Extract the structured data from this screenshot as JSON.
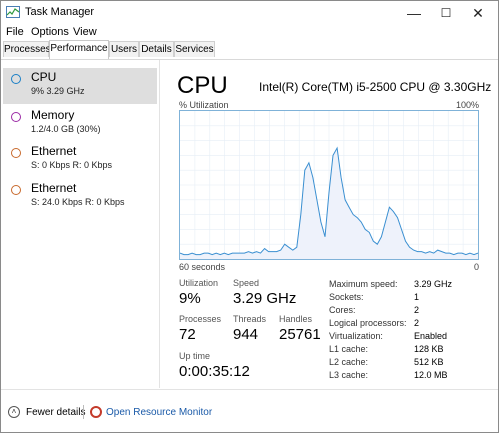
{
  "window": {
    "title": "Task Manager",
    "minimize": "—",
    "maximize": "☐",
    "close": "✕"
  },
  "menu": {
    "items": [
      "File",
      "Options",
      "View"
    ]
  },
  "tabs": [
    "Processes",
    "Performance",
    "Users",
    "Details",
    "Services"
  ],
  "active_tab": "Performance",
  "sidebar": {
    "items": [
      {
        "title": "CPU",
        "subtitle": "9% 3.29 GHz",
        "color": "#1a7fc6"
      },
      {
        "title": "Memory",
        "subtitle": "1.2/4.0 GB (30%)",
        "color": "#9b2aa5"
      },
      {
        "title": "Ethernet",
        "subtitle": "S: 0 Kbps  R: 0 Kbps",
        "color": "#c8692c"
      },
      {
        "title": "Ethernet",
        "subtitle": "S: 24.0 Kbps  R: 0 Kbps",
        "color": "#c8692c"
      }
    ]
  },
  "main": {
    "title": "CPU",
    "model": "Intel(R) Core(TM) i5-2500 CPU @ 3.30GHz",
    "graph": {
      "y_label": "% Utilization",
      "y_max_label": "100%",
      "x_left_label": "60 seconds",
      "x_right_label": "0",
      "line_color": "#3a8fd1",
      "fill_color": "#eef2fb",
      "samples": [
        4,
        3,
        3,
        4,
        3,
        3,
        4,
        4,
        3,
        4,
        3,
        4,
        3,
        4,
        4,
        4,
        4,
        5,
        4,
        5,
        4,
        7,
        5,
        5,
        5,
        6,
        10,
        8,
        6,
        8,
        30,
        60,
        65,
        55,
        40,
        25,
        15,
        45,
        70,
        75,
        55,
        40,
        35,
        30,
        28,
        25,
        20,
        18,
        12,
        10,
        15,
        25,
        35,
        32,
        28,
        20,
        12,
        8,
        6,
        5,
        5,
        4,
        5,
        4,
        6,
        5,
        4,
        4,
        3,
        4,
        4,
        3,
        4,
        3,
        4
      ]
    },
    "stats": {
      "utilization_label": "Utilization",
      "utilization": "9%",
      "speed_label": "Speed",
      "speed": "3.29 GHz",
      "processes_label": "Processes",
      "processes": "72",
      "threads_label": "Threads",
      "threads": "944",
      "handles_label": "Handles",
      "handles": "25761",
      "uptime_label": "Up time",
      "uptime": "0:00:35:12"
    },
    "info": [
      {
        "label": "Maximum speed:",
        "value": "3.29 GHz"
      },
      {
        "label": "Sockets:",
        "value": "1"
      },
      {
        "label": "Cores:",
        "value": "2"
      },
      {
        "label": "Logical processors:",
        "value": "2"
      },
      {
        "label": "Virtualization:",
        "value": "Enabled"
      },
      {
        "label": "L1 cache:",
        "value": "128 KB"
      },
      {
        "label": "L2 cache:",
        "value": "512 KB"
      },
      {
        "label": "L3 cache:",
        "value": "12.0 MB"
      }
    ]
  },
  "footer": {
    "fewer_details": "Fewer details",
    "open_monitor": "Open Resource Monitor"
  }
}
